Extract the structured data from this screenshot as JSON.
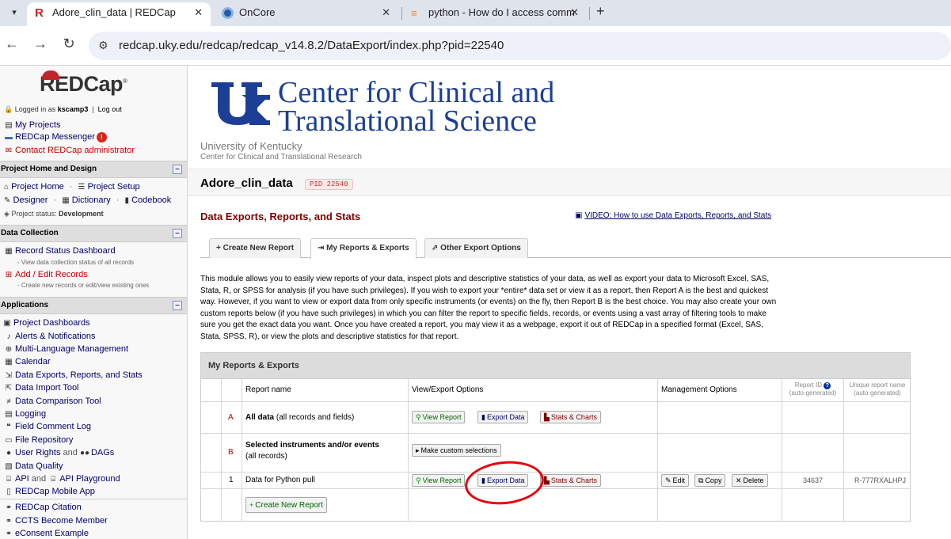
{
  "browser": {
    "tabs": [
      {
        "title": "Adore_clin_data | REDCap",
        "active": true
      },
      {
        "title": "OnCore",
        "active": false
      },
      {
        "title": "python - How do I access comm",
        "active": false
      }
    ],
    "url": "redcap.uky.edu/redcap/redcap_v14.8.2/DataExport/index.php?pid=22540"
  },
  "sidebar": {
    "logo": "REDCap",
    "logged_in_prefix": "Logged in as",
    "username": "kscamp3",
    "logout": "Log out",
    "top_links": [
      "My Projects",
      "REDCap Messenger",
      "Contact REDCap administrator"
    ],
    "messenger_badge": "!",
    "sections": {
      "home_design": {
        "title": "Project Home and Design",
        "row1": [
          "Project Home",
          "Project Setup"
        ],
        "row2": [
          "Designer",
          "Dictionary",
          "Codebook"
        ],
        "status_label": "Project status:",
        "status_value": "Development"
      },
      "data_collection": {
        "title": "Data Collection",
        "record_status": "Record Status Dashboard",
        "record_status_note": "- View data collection status of all records",
        "add_edit": "Add / Edit Records",
        "add_edit_note": "- Create new records or edit/view existing ones"
      },
      "applications": {
        "title": "Applications",
        "items": [
          "Project Dashboards",
          "Alerts & Notifications",
          "Multi-Language Management",
          "Calendar",
          "Data Exports, Reports, and Stats",
          "Data Import Tool",
          "Data Comparison Tool",
          "Logging",
          "Field Comment Log",
          "File Repository"
        ],
        "user_rights": "User Rights",
        "and": "and",
        "dags": "DAGs",
        "data_quality": "Data Quality",
        "api": "API",
        "api_playground": "API Playground",
        "mobile_app": "REDCap Mobile App"
      },
      "bottom_links": [
        "REDCap Citation",
        "CCTS Become Member",
        "eConsent Example"
      ]
    }
  },
  "header": {
    "banner_line1": "Center for Clinical and",
    "banner_line2": "Translational Science",
    "university": "University of Kentucky",
    "center": "Center for Clinical and Translational Research",
    "project_title": "Adore_clin_data",
    "pid": "PID 22540"
  },
  "page": {
    "title": "Data Exports, Reports, and Stats",
    "video_link": "VIDEO: How to use Data Exports, Reports, and Stats",
    "tabs": [
      "Create New Report",
      "My Reports & Exports",
      "Other Export Options"
    ],
    "intro": "This module allows you to easily view reports of your data, inspect plots and descriptive statistics of your data, as well as export your data to Microsoft Excel, SAS, Stata, R, or SPSS for analysis (if you have such privileges). If you wish to export your *entire* data set or view it as a report, then Report A is the best and quickest way. However, if you want to view or export data from only specific instruments (or events) on the fly, then Report B is the best choice. You may also create your own custom reports below (if you have such privileges) in which you can filter the report to specific fields, records, or events using a vast array of filtering tools to make sure you get the exact data you want. Once you have created a report, you may view it as a webpage, export it out of REDCap in a specified format (Excel, SAS, Stata, SPSS, R), or view the plots and descriptive statistics for that report."
  },
  "reports": {
    "heading": "My Reports & Exports",
    "columns": {
      "name": "Report name",
      "options": "View/Export Options",
      "management": "Management Options",
      "report_id": "Report ID",
      "report_id_sub": "(auto-generated)",
      "unique_name": "Unique report name",
      "unique_name_sub": "(auto-generated)"
    },
    "row_a": {
      "letter": "A",
      "name_bold": "All data",
      "name_rest": "(all records and fields)"
    },
    "row_b": {
      "letter": "B",
      "name_bold": "Selected instruments and/or events",
      "name_rest": "(all records)",
      "button": "Make custom selections"
    },
    "row_1": {
      "num": "1",
      "name": "Data for Python pull",
      "report_id": "34637",
      "unique_name": "R-777RXALHPJ"
    },
    "buttons": {
      "view": "View Report",
      "export": "Export Data",
      "stats": "Stats & Charts",
      "edit": "Edit",
      "copy": "Copy",
      "delete": "Delete",
      "create": "Create New Report"
    }
  }
}
